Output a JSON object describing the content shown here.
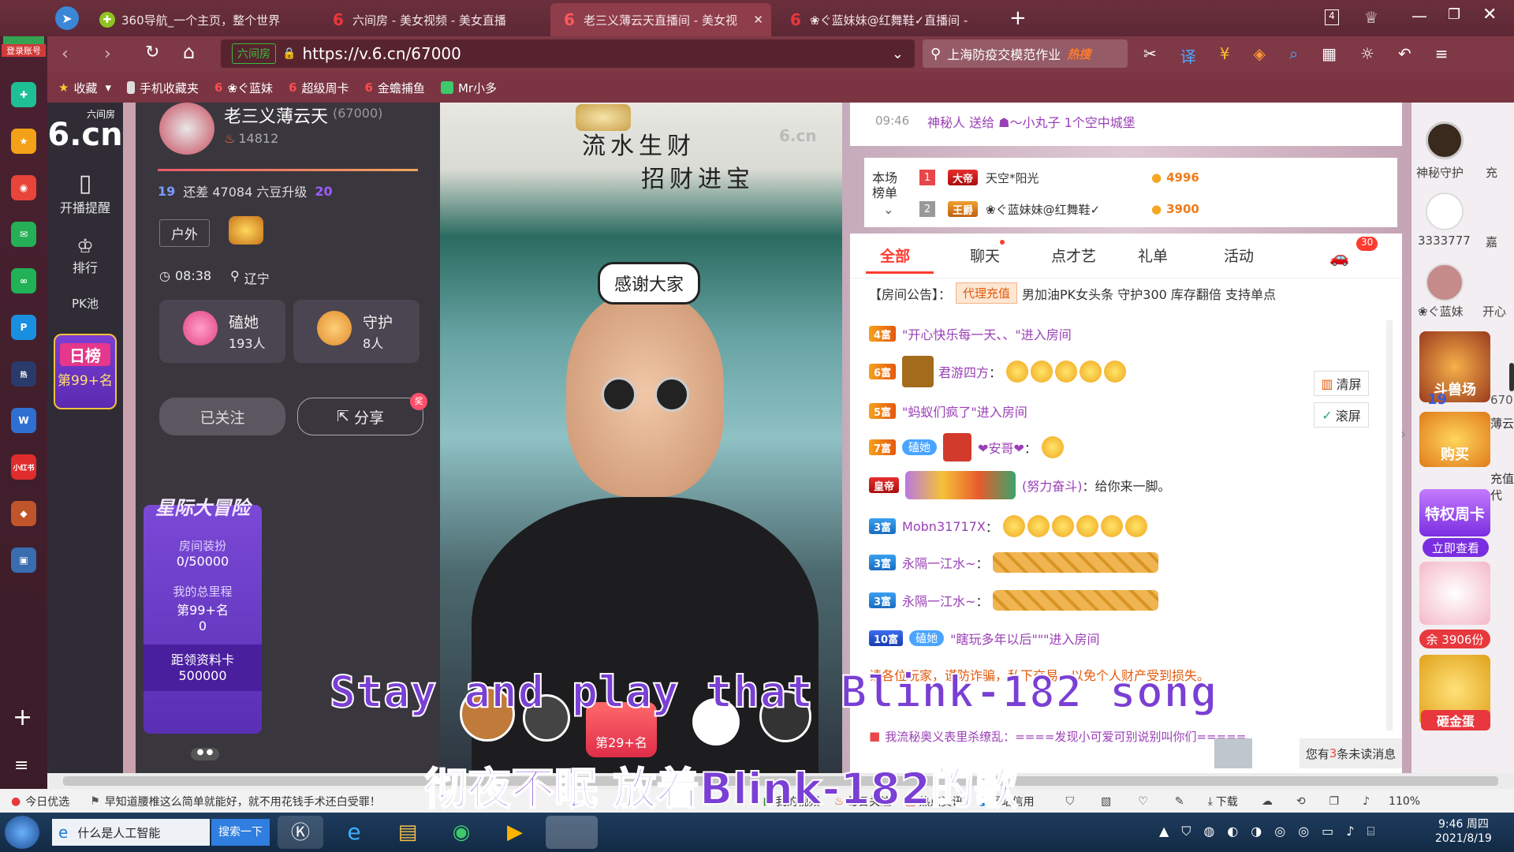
{
  "tabs": [
    {
      "label": "360导航_一个主页，整个世界",
      "icon": "360-icon"
    },
    {
      "label": "六间房 - 美女视频 - 美女直播",
      "icon": "6cn-icon"
    },
    {
      "label": "老三义薄云天直播间 - 美女视",
      "icon": "6cn-icon"
    },
    {
      "label": "❀ぐ蓝妹妹@红舞鞋✓直播间 -",
      "icon": "6cn-icon"
    }
  ],
  "tab_count": "4",
  "address": {
    "site_tag": "六间房",
    "url": "https://v.6.cn/67000"
  },
  "search": {
    "text": "上海防疫交模范作业",
    "hot": "热搜"
  },
  "bookmarks": [
    "收藏",
    "手机收藏夹",
    "❀ぐ蓝妹",
    "超级周卡",
    "金蟾捕鱼",
    "Mr小多"
  ],
  "login_label": "登录账号",
  "site": {
    "logo_small": "六间房",
    "logo": "6.cn",
    "nav": [
      {
        "label": "开播提醒"
      },
      {
        "label": "排行"
      },
      {
        "label": "PK池"
      }
    ],
    "daily_rank": {
      "title": "日榜",
      "rank": "第99+名"
    }
  },
  "anchor": {
    "name": "老三义薄云天",
    "room_id": "(67000)",
    "heat": "14812",
    "level_from": "19",
    "level_text": "还差 47084 六豆升级",
    "level_to": "20",
    "tag": "户外",
    "time": "08:38",
    "location": "辽宁",
    "fans_label": "磕她",
    "fans_count": "193人",
    "guard_label": "守护",
    "guard_count": "8人",
    "followed": "已关注",
    "share": "分享",
    "share_badge": "奖",
    "adventure": {
      "title": "星际大冒险",
      "room_dress": "房间装扮",
      "room_dress_val": "0/50000",
      "mileage": "我的总里程",
      "mileage_rank": "第99+名",
      "mileage_val": "0",
      "card_label": "距领资料卡",
      "card_val": "500000"
    }
  },
  "video": {
    "calligraphy1": "流水生财",
    "calligraphy2": "招财进宝",
    "watermark": "6.cn",
    "bubble": "感谢大家",
    "rank_badge": "第29+名",
    "subtitle_en": "Stay and play that Blink-182 song",
    "subtitle_cn": "彻夜不眠 放着Blink-182的歌"
  },
  "chat_top": {
    "time": "09:46",
    "text": "神秘人 送给 ☗〜小丸子 1个空中城堡"
  },
  "rank": {
    "title": "本场榜单",
    "rows": [
      {
        "num": "1",
        "badge": "大帝",
        "name": "天空*阳光",
        "coins": "4996"
      },
      {
        "num": "2",
        "badge": "王爵",
        "name": "❀ぐ蓝妹妹@红舞鞋✓",
        "coins": "3900"
      }
    ]
  },
  "chat_tabs": [
    "全部",
    "聊天",
    "点才艺",
    "礼单",
    "活动"
  ],
  "chat_tab_badge": "30",
  "announcement": {
    "label": "【房间公告】：",
    "tag": "代理充值",
    "text": "男加油PK女头条 守护300 库存翻倍 支持单点"
  },
  "chat": [
    {
      "badge": "4富",
      "text": "\"开心快乐每一天、、\"进入房间"
    },
    {
      "badge": "6富",
      "user": "君游四方",
      "text": "："
    },
    {
      "badge": "5富",
      "text": "\"蚂蚁们疯了\"进入房间"
    },
    {
      "badge": "7富",
      "fan": "磕她",
      "user": "❤安哥❤",
      "text": "："
    },
    {
      "badge": "皇帝",
      "user": "(努力奋斗)",
      "text": "：给你来一脚。"
    },
    {
      "badge": "3富",
      "user": "Mobn31717X",
      "text": "："
    },
    {
      "badge": "3富",
      "user": "永隔一江水~",
      "text": "："
    },
    {
      "badge": "3富",
      "user": "永隔一江水~",
      "text": "："
    },
    {
      "badge": "10富",
      "fan": "磕她",
      "text": "\"瞎玩多年以后\"\"\"进入房间"
    }
  ],
  "notice": "请各位玩家，谨防诈骗，私下交易，以免个人财产受到损失。",
  "chat_last": "我流秘奥义表里杀缭乱：====发现小可爱可别说别叫你们=====",
  "chat_tools": {
    "clear": "清屏",
    "scroll": "滚屏"
  },
  "unread": {
    "pre": "您有",
    "num": "3",
    "post": "条未读消息"
  },
  "guards": [
    {
      "name": "神秘守护"
    },
    {
      "name": "3333777"
    },
    {
      "name": "❀ぐ蓝妹"
    }
  ],
  "guards_right": [
    "充",
    "嘉",
    "开心"
  ],
  "promos": {
    "arena": "斗兽场",
    "buy": "购买",
    "vip": "特权周卡",
    "view": "立即查看",
    "remain": "余 3906份",
    "egg": "砸金蛋",
    "side_a": "670",
    "side_b": "薄云",
    "side_c": "充值代"
  },
  "statusbar": {
    "left1": "今日优选",
    "left2": "早知道腰椎这么简单就能好，就不用花钱手术还白受罪！",
    "items": [
      "我的视频",
      "每日关注",
      "热点资讯",
      "网站信用",
      "下载"
    ],
    "zoom": "110%"
  },
  "taskbar": {
    "active_window": "什么是人工智能",
    "search_btn": "搜索一下",
    "time": "9:46 周四",
    "date": "2021/8/19"
  },
  "colors": {
    "brand": "#e8383d",
    "accent": "#ff6600",
    "purple": "#7a3fd4"
  }
}
